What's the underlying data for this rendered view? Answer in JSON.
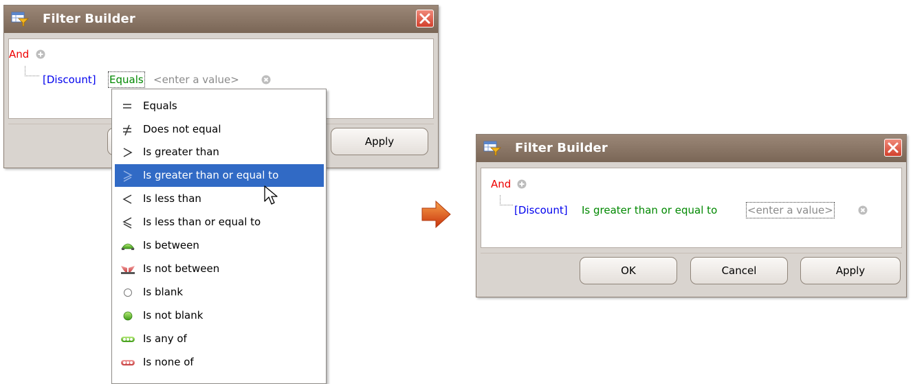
{
  "dialog1": {
    "title": "Filter Builder",
    "and": "And",
    "field": "[Discount]",
    "operator": "Equals",
    "value_placeholder": "<enter a value>",
    "apply_label": "Apply"
  },
  "operator_menu": {
    "items": [
      {
        "icon": "equals-icon",
        "label": "Equals"
      },
      {
        "icon": "not-equal-icon",
        "label": "Does not equal"
      },
      {
        "icon": "greater-than-icon",
        "label": "Is greater than"
      },
      {
        "icon": "greater-or-equal-icon",
        "label": "Is greater than or equal to",
        "selected": true
      },
      {
        "icon": "less-than-icon",
        "label": "Is less than"
      },
      {
        "icon": "less-or-equal-icon",
        "label": "Is less than or equal to"
      },
      {
        "icon": "between-icon",
        "label": "Is between"
      },
      {
        "icon": "not-between-icon",
        "label": "Is not between"
      },
      {
        "icon": "blank-icon",
        "label": "Is blank"
      },
      {
        "icon": "not-blank-icon",
        "label": "Is not blank"
      },
      {
        "icon": "any-of-icon",
        "label": "Is any of"
      },
      {
        "icon": "none-of-icon",
        "label": "Is none of"
      }
    ]
  },
  "dialog2": {
    "title": "Filter Builder",
    "and": "And",
    "field": "[Discount]",
    "operator": "Is greater than or equal to",
    "value_placeholder": "<enter a value>",
    "ok_label": "OK",
    "cancel_label": "Cancel",
    "apply_label": "Apply"
  },
  "colors": {
    "title_bar": "#8a7767",
    "and_text": "#ee0000",
    "field_text": "#0000ee",
    "operator_text": "#008800",
    "selection": "#316ac5",
    "arrow": "#e04a12"
  }
}
